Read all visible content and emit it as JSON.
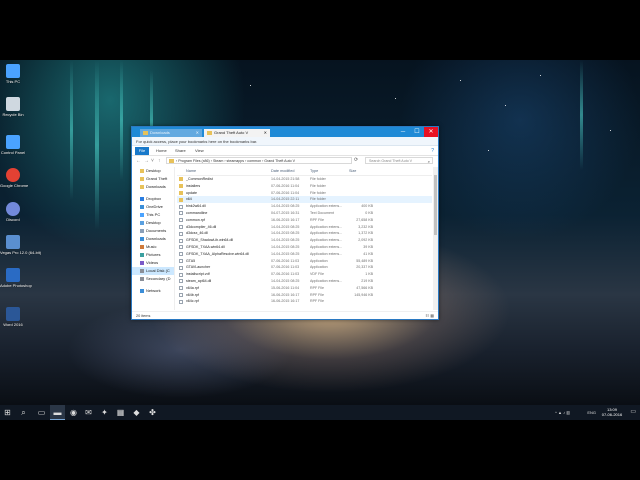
{
  "desktop_icons": [
    {
      "label": "This PC",
      "icon": "monitor-icon",
      "color": "#4aa3ff"
    },
    {
      "label": "Recycle Bin",
      "icon": "recycle-bin-icon",
      "color": "#cfd8e0"
    },
    {
      "label": "Control Panel",
      "icon": "control-panel-icon",
      "color": "#4aa3ff"
    },
    {
      "label": "Google Chrome",
      "icon": "chrome-icon",
      "color": "#e34133"
    },
    {
      "label": "Discord",
      "icon": "discord-icon",
      "color": "#7289da"
    },
    {
      "label": "Vegas Pro 12.0 (64-bit)",
      "icon": "vegas-icon",
      "color": "#5a8fd0"
    },
    {
      "label": "Adobe Photoshop",
      "icon": "photoshop-icon",
      "color": "#2a6bc4"
    },
    {
      "label": "Word 2016",
      "icon": "word-icon",
      "color": "#2b5797"
    }
  ],
  "explorer": {
    "tabs": [
      {
        "label": "Downloads",
        "icon": "folder-icon",
        "active": false
      },
      {
        "label": "Grand Theft Auto V",
        "icon": "folder-icon",
        "active": true
      }
    ],
    "window_buttons": {
      "minimize": "─",
      "maximize": "☐",
      "close": "✕"
    },
    "bookmarks_bar_text": "For quick access, place your bookmarks here on the bookmarks bar.",
    "ribbon": {
      "file": "File",
      "tabs": [
        "Home",
        "Share",
        "View"
      ],
      "help": "?"
    },
    "nav_buttons": {
      "back": "←",
      "forward": "→",
      "recent": "˅",
      "up": "↑"
    },
    "address_path": "›  Program Files (x86)  ›  Steam  ›  steamapps  ›  common  ›  Grand Theft Auto V",
    "refresh": "⟳",
    "search_placeholder": "Search Grand Theft Auto V",
    "nav_pane": [
      {
        "label": "Desktop",
        "icon": "folder-icon",
        "color": "#e8c25a",
        "selected": false
      },
      {
        "label": "Grand Theft",
        "icon": "folder-icon",
        "color": "#e8c25a",
        "selected": false
      },
      {
        "label": "Downloads",
        "icon": "folder-icon",
        "color": "#e8c25a",
        "selected": false
      },
      {
        "label": "",
        "icon": "spacer",
        "color": "",
        "selected": false
      },
      {
        "label": "Dropbox",
        "icon": "dropbox-icon",
        "color": "#2a7de1",
        "selected": false
      },
      {
        "label": "OneDrive",
        "icon": "cloud-icon",
        "color": "#3b8ed8",
        "selected": false
      },
      {
        "label": "This PC",
        "icon": "monitor-icon",
        "color": "#4aa3ff",
        "selected": false
      },
      {
        "label": "Desktop",
        "icon": "folder-icon",
        "color": "#5aa0e0",
        "selected": false
      },
      {
        "label": "Documents",
        "icon": "folder-icon",
        "color": "#8ba0b8",
        "selected": false
      },
      {
        "label": "Downloads",
        "icon": "download-icon",
        "color": "#3b8ed8",
        "selected": false
      },
      {
        "label": "Music",
        "icon": "music-icon",
        "color": "#d07a3a",
        "selected": false
      },
      {
        "label": "Pictures",
        "icon": "pictures-icon",
        "color": "#3aa0a0",
        "selected": false
      },
      {
        "label": "Videos",
        "icon": "video-icon",
        "color": "#7a5ac8",
        "selected": false
      },
      {
        "label": "Local Disk (C",
        "icon": "drive-icon",
        "color": "#8a8f98",
        "selected": true
      },
      {
        "label": "Secondary (D",
        "icon": "drive-icon",
        "color": "#8a8f98",
        "selected": false
      },
      {
        "label": "",
        "icon": "spacer",
        "color": "",
        "selected": false
      },
      {
        "label": "Network",
        "icon": "network-icon",
        "color": "#3b8ed8",
        "selected": false
      }
    ],
    "columns": {
      "name": "Name",
      "date": "Date modified",
      "type": "Type",
      "size": "Size"
    },
    "files": [
      {
        "name": "_CommonRedist",
        "date": "14-04-2015 21:58",
        "type": "File folder",
        "size": "",
        "kind": "folder"
      },
      {
        "name": "installers",
        "date": "07-06-2016 11:04",
        "type": "File folder",
        "size": "",
        "kind": "folder"
      },
      {
        "name": "update",
        "date": "07-06-2016 11:04",
        "type": "File folder",
        "size": "",
        "kind": "folder"
      },
      {
        "name": "x64",
        "date": "14-04-2015 22:11",
        "type": "File folder",
        "size": "",
        "kind": "folder"
      },
      {
        "name": "bink2w64.dll",
        "date": "14-04-2015 08:25",
        "type": "Application extens...",
        "size": "400 KB",
        "kind": "file"
      },
      {
        "name": "commandline",
        "date": "04-07-2015 16:31",
        "type": "Text Document",
        "size": "0 KB",
        "kind": "file"
      },
      {
        "name": "common.rpf",
        "date": "16-06-2015 16:17",
        "type": "RPF File",
        "size": "27,658 KB",
        "kind": "file"
      },
      {
        "name": "d3dcompiler_46.dll",
        "date": "14-04-2015 08:25",
        "type": "Application extens...",
        "size": "3,232 KB",
        "kind": "file"
      },
      {
        "name": "d3dcsx_46.dll",
        "date": "14-04-2015 08:25",
        "type": "Application extens...",
        "size": "1,372 KB",
        "kind": "file"
      },
      {
        "name": "GFSDK_ShadowLib.win64.dll",
        "date": "14-04-2015 08:25",
        "type": "Application extens...",
        "size": "2,092 KB",
        "kind": "file"
      },
      {
        "name": "GFSDK_TXAA.win64.dll",
        "date": "14-04-2015 08:25",
        "type": "Application extens...",
        "size": "39 KB",
        "kind": "file"
      },
      {
        "name": "GFSDK_TXAA_AlphaResolve.win64.dll",
        "date": "14-04-2015 08:25",
        "type": "Application extens...",
        "size": "41 KB",
        "kind": "file"
      },
      {
        "name": "GTA5",
        "date": "07-06-2016 11:03",
        "type": "Application",
        "size": "55,489 KB",
        "kind": "file"
      },
      {
        "name": "GTAVLauncher",
        "date": "07-06-2016 11:03",
        "type": "Application",
        "size": "20,337 KB",
        "kind": "file"
      },
      {
        "name": "installscript.vdf",
        "date": "07-06-2016 11:03",
        "type": "VDF File",
        "size": "1 KB",
        "kind": "file"
      },
      {
        "name": "steam_api64.dll",
        "date": "14-04-2015 08:25",
        "type": "Application extens...",
        "size": "219 KB",
        "kind": "file"
      },
      {
        "name": "x64a.rpf",
        "date": "15-06-2016 11:04",
        "type": "RPF File",
        "size": "47,566 KB",
        "kind": "file"
      },
      {
        "name": "x64b.rpf",
        "date": "16-06-2015 16:17",
        "type": "RPF File",
        "size": "145,946 KB",
        "kind": "file"
      },
      {
        "name": "x64c.rpf",
        "date": "16-06-2015 16:17",
        "type": "RPF File",
        "size": "",
        "kind": "file"
      }
    ],
    "hovered_row": 3,
    "status": "20 items",
    "view_toggles": "☷ ▦"
  },
  "taskbar": {
    "items": [
      {
        "icon": "windows-start-icon",
        "glyph": "⊞",
        "active": false
      },
      {
        "icon": "search-icon",
        "glyph": "⌕",
        "active": false
      },
      {
        "icon": "task-view-icon",
        "glyph": "▭",
        "active": false
      },
      {
        "icon": "file-explorer-icon",
        "glyph": "▬",
        "active": true
      },
      {
        "icon": "chrome-icon",
        "glyph": "◉",
        "active": false
      },
      {
        "icon": "mail-icon",
        "glyph": "✉",
        "active": false
      },
      {
        "icon": "network-tool-icon",
        "glyph": "✦",
        "active": false
      },
      {
        "icon": "calculator-icon",
        "glyph": "▦",
        "active": false
      },
      {
        "icon": "app-icon",
        "glyph": "◆",
        "active": false
      },
      {
        "icon": "game-icon",
        "glyph": "✤",
        "active": false
      }
    ],
    "tray_icons": "^  ▲  ♪  ▥",
    "language": "ENG",
    "time": "13:09",
    "date": "07-06-2016",
    "notification_glyph": "▭"
  }
}
